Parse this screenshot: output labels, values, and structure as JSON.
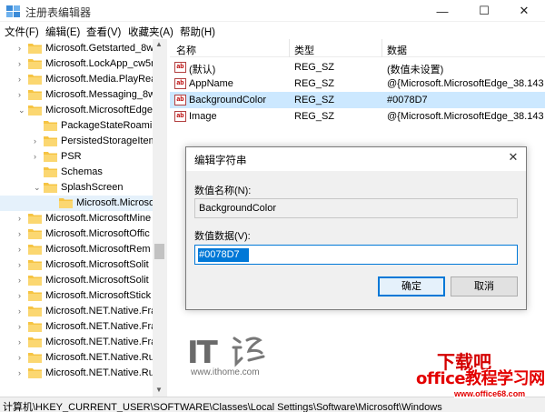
{
  "window": {
    "title": "注册表编辑器",
    "min_glyph": "—",
    "max_glyph": "☐",
    "close_glyph": "✕"
  },
  "menu": [
    "文件(F)",
    "编辑(E)",
    "查看(V)",
    "收藏夹(A)",
    "帮助(H)"
  ],
  "tree": [
    {
      "label": "Microsoft.Getstarted_8w",
      "indent": 0,
      "arrow": "›"
    },
    {
      "label": "Microsoft.LockApp_cw5n",
      "indent": 0,
      "arrow": "›"
    },
    {
      "label": "Microsoft.Media.PlayRea",
      "indent": 0,
      "arrow": "›"
    },
    {
      "label": "Microsoft.Messaging_8w",
      "indent": 0,
      "arrow": "›"
    },
    {
      "label": "Microsoft.MicrosoftEdge",
      "indent": 0,
      "arrow": "⌄"
    },
    {
      "label": "PackageStateRoamin",
      "indent": 1,
      "arrow": ""
    },
    {
      "label": "PersistedStorageItem",
      "indent": 1,
      "arrow": "›"
    },
    {
      "label": "PSR",
      "indent": 1,
      "arrow": "›"
    },
    {
      "label": "Schemas",
      "indent": 1,
      "arrow": ""
    },
    {
      "label": "SplashScreen",
      "indent": 1,
      "arrow": "⌄"
    },
    {
      "label": "Microsoft.Microso",
      "indent": 2,
      "arrow": "",
      "selected": true
    },
    {
      "label": "Microsoft.MicrosoftMine",
      "indent": 0,
      "arrow": "›"
    },
    {
      "label": "Microsoft.MicrosoftOffic",
      "indent": 0,
      "arrow": "›"
    },
    {
      "label": "Microsoft.MicrosoftRem",
      "indent": 0,
      "arrow": "›"
    },
    {
      "label": "Microsoft.MicrosoftSolit",
      "indent": 0,
      "arrow": "›"
    },
    {
      "label": "Microsoft.MicrosoftSolit",
      "indent": 0,
      "arrow": "›"
    },
    {
      "label": "Microsoft.MicrosoftStick",
      "indent": 0,
      "arrow": "›"
    },
    {
      "label": "Microsoft.NET.Native.Fra",
      "indent": 0,
      "arrow": "›"
    },
    {
      "label": "Microsoft.NET.Native.Fra",
      "indent": 0,
      "arrow": "›"
    },
    {
      "label": "Microsoft.NET.Native.Fra",
      "indent": 0,
      "arrow": "›"
    },
    {
      "label": "Microsoft.NET.Native.Ru",
      "indent": 0,
      "arrow": "›"
    },
    {
      "label": "Microsoft.NET.Native.Ru",
      "indent": 0,
      "arrow": "›"
    }
  ],
  "list": {
    "headers": [
      "名称",
      "类型",
      "数据"
    ],
    "rows": [
      {
        "name": "(默认)",
        "type": "REG_SZ",
        "data": "(数值未设置)"
      },
      {
        "name": "AppName",
        "type": "REG_SZ",
        "data": "@{Microsoft.MicrosoftEdge_38.143"
      },
      {
        "name": "BackgroundColor",
        "type": "REG_SZ",
        "data": "#0078D7",
        "selected": true
      },
      {
        "name": "Image",
        "type": "REG_SZ",
        "data": "@{Microsoft.MicrosoftEdge_38.143"
      }
    ],
    "icon_text": "ab"
  },
  "status": "计算机\\HKEY_CURRENT_USER\\SOFTWARE\\Classes\\Local Settings\\Software\\Microsoft\\Windows",
  "dialog": {
    "title": "编辑字符串",
    "name_label": "数值名称(N):",
    "name_value": "BackgroundColor",
    "data_label": "数值数据(V):",
    "data_value": "#0078D7",
    "ok_label": "确定",
    "cancel_label": "取消",
    "close_glyph": "✕"
  },
  "watermarks": {
    "ithome_logo": "IT",
    "ithome_url": "www.ithome.com",
    "office_text": "office教程学习网",
    "office_url": "www.office68.com"
  },
  "colors": {
    "accent": "#0078d7",
    "selection": "#cce8ff",
    "folder": "#f6c443",
    "watermark_red": "#e30000"
  }
}
